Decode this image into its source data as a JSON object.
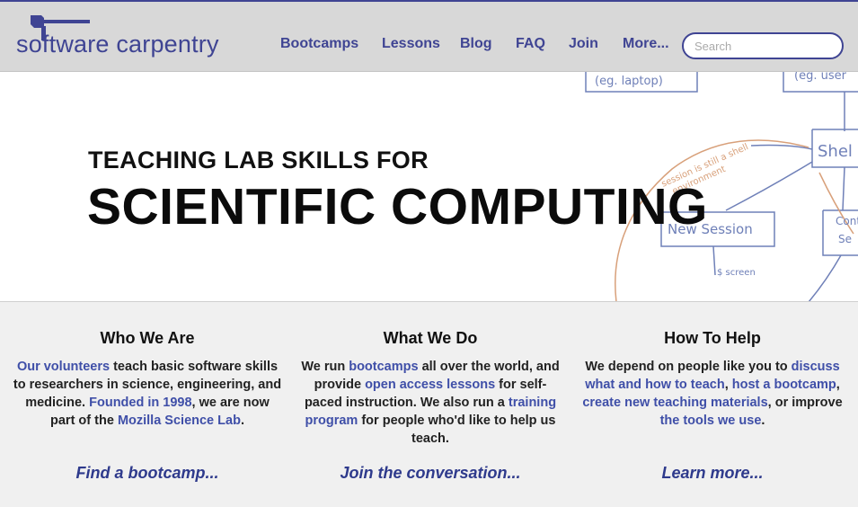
{
  "header": {
    "logo_text": "software carpentry",
    "nav": [
      {
        "label": "Bootcamps"
      },
      {
        "label": "Lessons"
      },
      {
        "label": "Blog"
      },
      {
        "label": "FAQ"
      },
      {
        "label": "Join"
      },
      {
        "label": "More..."
      }
    ],
    "search_placeholder": "Search"
  },
  "hero": {
    "subtitle": "TEACHING LAB SKILLS FOR",
    "title": "SCIENTIFIC COMPUTING",
    "sketch": {
      "box1": "(eg. laptop)",
      "box2": "(eg. user",
      "box3": "Shel",
      "box4": "New Session",
      "box5a": "Cont",
      "box5b": "Se",
      "note1": "session is still a shell",
      "note2": "environment",
      "note3": "$ screen"
    }
  },
  "columns": [
    {
      "heading": "Who We Are",
      "segments": [
        {
          "text": "Our volunteers",
          "link": true
        },
        {
          "text": " teach basic software skills to researchers in science, engineering, and medicine. ",
          "link": false
        },
        {
          "text": "Founded in 1998",
          "link": true
        },
        {
          "text": ", we are now part of the ",
          "link": false
        },
        {
          "text": "Mozilla Science Lab",
          "link": true
        },
        {
          "text": ".",
          "link": false
        }
      ],
      "cta": "Find a bootcamp..."
    },
    {
      "heading": "What We Do",
      "segments": [
        {
          "text": "We run ",
          "link": false
        },
        {
          "text": "bootcamps",
          "link": true
        },
        {
          "text": " all over the world, and provide ",
          "link": false
        },
        {
          "text": "open access lessons",
          "link": true
        },
        {
          "text": " for self-paced instruction. We also run a ",
          "link": false
        },
        {
          "text": "training program",
          "link": true
        },
        {
          "text": " for people who'd like to help us teach.",
          "link": false
        }
      ],
      "cta": "Join the conversation..."
    },
    {
      "heading": "How To Help",
      "segments": [
        {
          "text": "We depend on people like you to ",
          "link": false
        },
        {
          "text": "discuss what and how to teach",
          "link": true
        },
        {
          "text": ", ",
          "link": false
        },
        {
          "text": "host a bootcamp",
          "link": true
        },
        {
          "text": ", ",
          "link": false
        },
        {
          "text": "create new teaching materials",
          "link": true
        },
        {
          "text": ", or improve ",
          "link": false
        },
        {
          "text": "the tools we use",
          "link": true
        },
        {
          "text": ".",
          "link": false
        }
      ],
      "cta": "Learn more..."
    }
  ],
  "colors": {
    "brand": "#3f4493",
    "link": "#3f4fa8",
    "header_bg": "#d8d8d8",
    "page_bg": "#f0f0f0",
    "sketch_blue": "#6f80b8",
    "sketch_orange": "#d8a07a"
  }
}
